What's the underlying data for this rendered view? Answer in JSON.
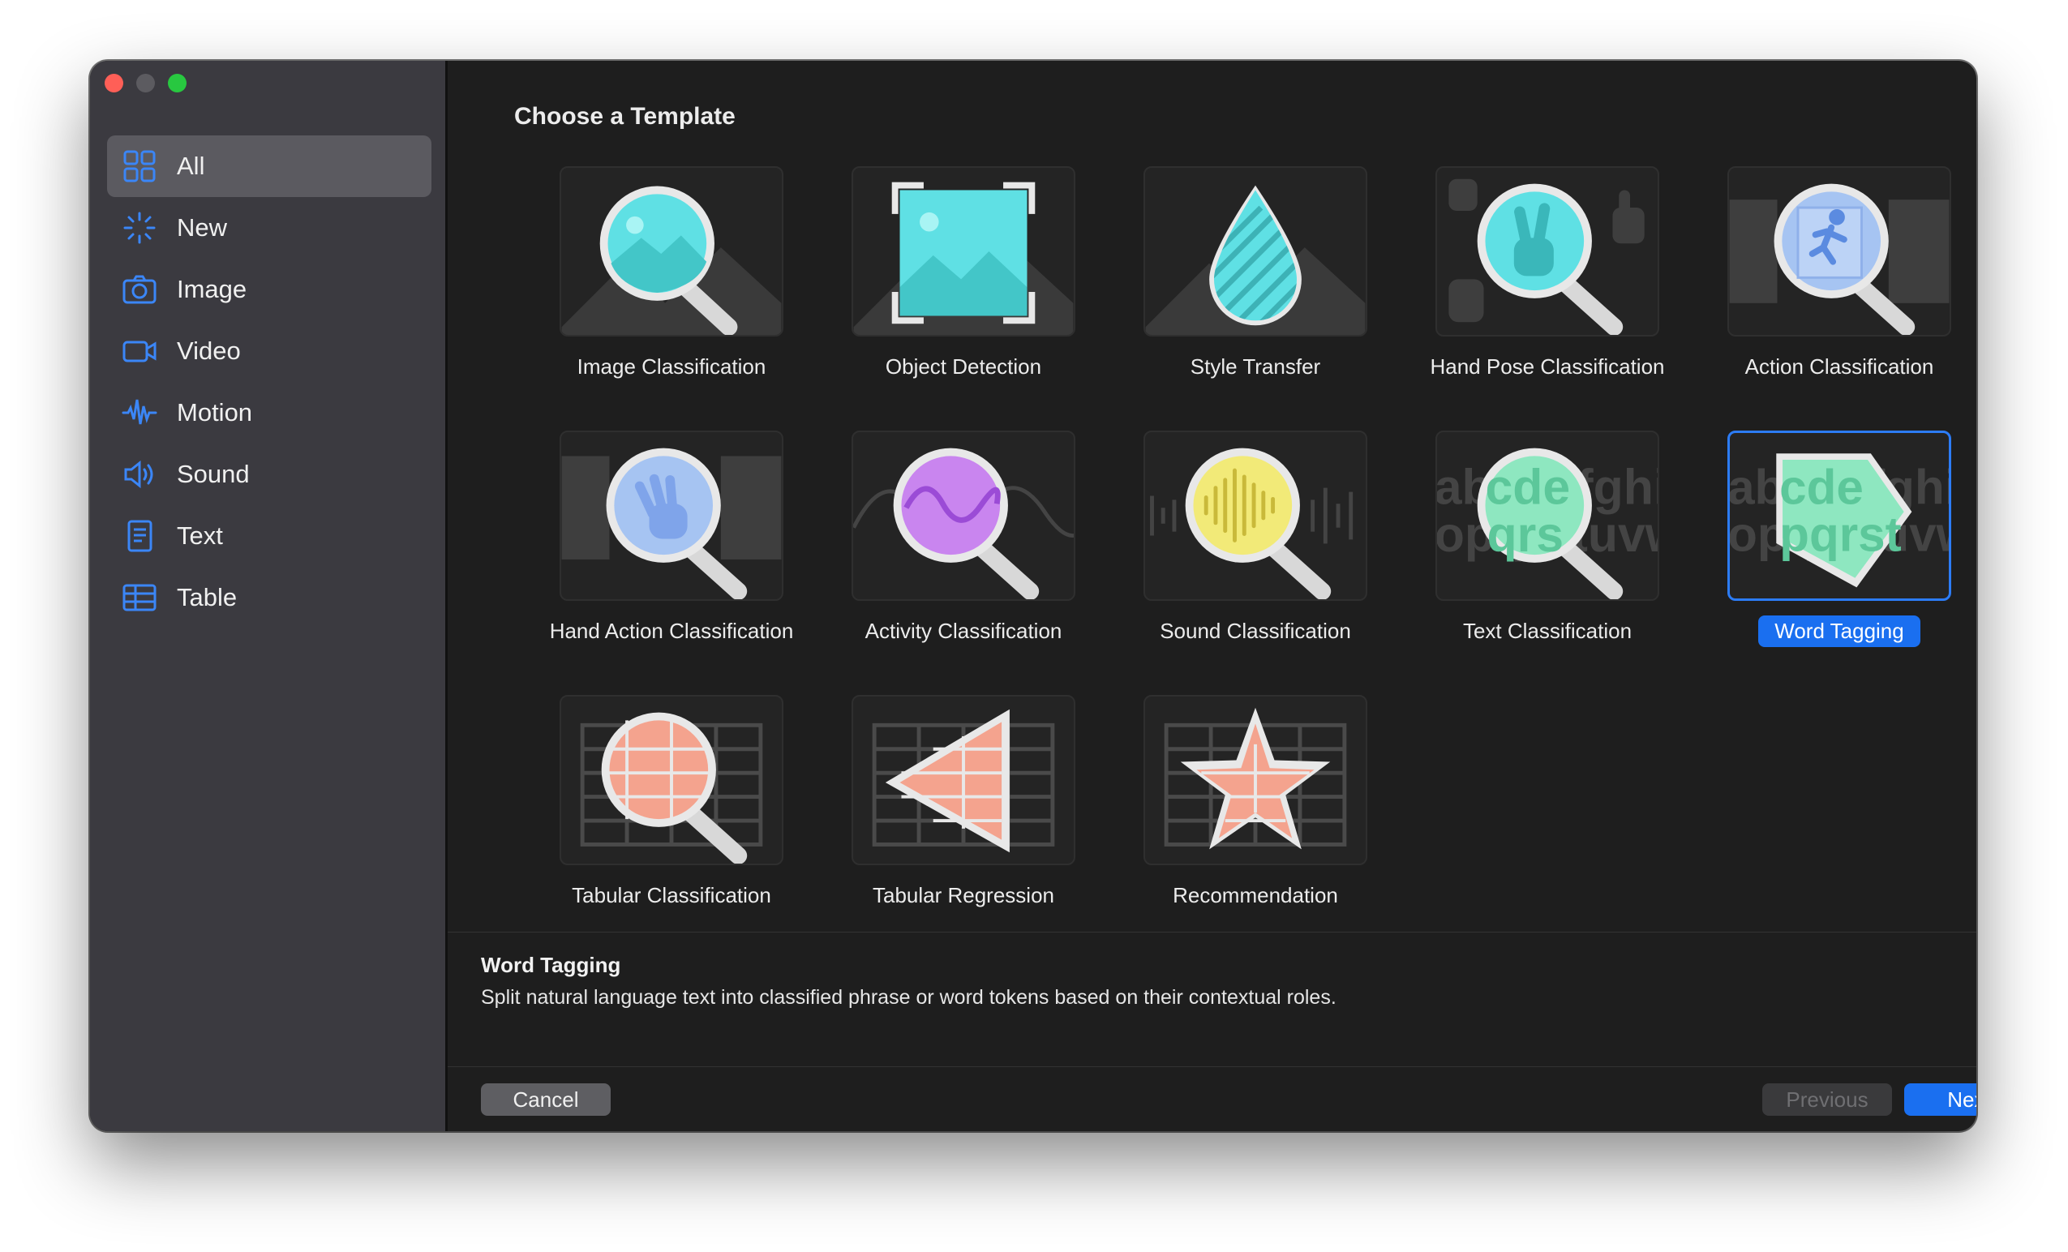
{
  "window": {
    "title": "Choose a Template"
  },
  "sidebar": {
    "items": [
      {
        "label": "All",
        "icon": "grid-icon",
        "selected": true
      },
      {
        "label": "New",
        "icon": "sparkle-icon"
      },
      {
        "label": "Image",
        "icon": "camera-icon"
      },
      {
        "label": "Video",
        "icon": "video-camera-icon"
      },
      {
        "label": "Motion",
        "icon": "waveform-icon"
      },
      {
        "label": "Sound",
        "icon": "speaker-icon"
      },
      {
        "label": "Text",
        "icon": "document-icon"
      },
      {
        "label": "Table",
        "icon": "table-icon"
      }
    ]
  },
  "templates": [
    {
      "label": "Image Classification",
      "icon": "image-magnifier-icon"
    },
    {
      "label": "Object Detection",
      "icon": "object-frame-icon"
    },
    {
      "label": "Style Transfer",
      "icon": "droplet-icon"
    },
    {
      "label": "Hand Pose Classification",
      "icon": "hand-peace-magnifier-icon"
    },
    {
      "label": "Action Classification",
      "icon": "running-person-magnifier-icon"
    },
    {
      "label": "Hand Action Classification",
      "icon": "waving-hand-magnifier-icon"
    },
    {
      "label": "Activity Classification",
      "icon": "sine-wave-magnifier-icon"
    },
    {
      "label": "Sound Classification",
      "icon": "audio-bars-magnifier-icon"
    },
    {
      "label": "Text Classification",
      "icon": "text-magnifier-icon"
    },
    {
      "label": "Word Tagging",
      "icon": "tag-icon",
      "selected": true
    },
    {
      "label": "Tabular Classification",
      "icon": "table-magnifier-icon"
    },
    {
      "label": "Tabular Regression",
      "icon": "triangle-table-icon"
    },
    {
      "label": "Recommendation",
      "icon": "star-table-icon"
    }
  ],
  "card_text": {
    "letters_top": "abcdefghi",
    "letters_bottom": "opqrstuvw"
  },
  "description": {
    "title": "Word Tagging",
    "text": "Split natural language text into classified phrase or word tokens based on their contextual roles."
  },
  "buttons": {
    "cancel": "Cancel",
    "previous": "Previous",
    "next": "Next"
  },
  "colors": {
    "accent": "#1a6ff0",
    "sidebar_bg": "#3b3a40",
    "main_bg": "#1e1e1e"
  }
}
